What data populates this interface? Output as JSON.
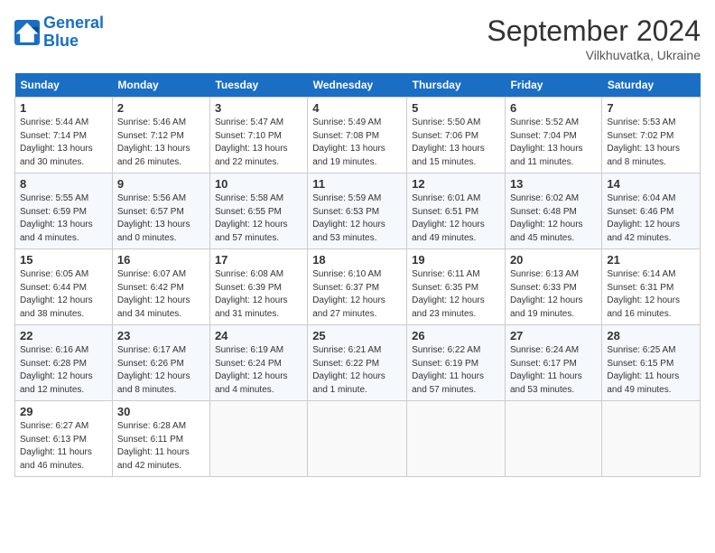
{
  "logo": {
    "text1": "General",
    "text2": "Blue"
  },
  "header": {
    "month": "September 2024",
    "location": "Vilkhuvatka, Ukraine"
  },
  "weekdays": [
    "Sunday",
    "Monday",
    "Tuesday",
    "Wednesday",
    "Thursday",
    "Friday",
    "Saturday"
  ],
  "weeks": [
    [
      {
        "day": "1",
        "info": "Sunrise: 5:44 AM\nSunset: 7:14 PM\nDaylight: 13 hours\nand 30 minutes."
      },
      {
        "day": "2",
        "info": "Sunrise: 5:46 AM\nSunset: 7:12 PM\nDaylight: 13 hours\nand 26 minutes."
      },
      {
        "day": "3",
        "info": "Sunrise: 5:47 AM\nSunset: 7:10 PM\nDaylight: 13 hours\nand 22 minutes."
      },
      {
        "day": "4",
        "info": "Sunrise: 5:49 AM\nSunset: 7:08 PM\nDaylight: 13 hours\nand 19 minutes."
      },
      {
        "day": "5",
        "info": "Sunrise: 5:50 AM\nSunset: 7:06 PM\nDaylight: 13 hours\nand 15 minutes."
      },
      {
        "day": "6",
        "info": "Sunrise: 5:52 AM\nSunset: 7:04 PM\nDaylight: 13 hours\nand 11 minutes."
      },
      {
        "day": "7",
        "info": "Sunrise: 5:53 AM\nSunset: 7:02 PM\nDaylight: 13 hours\nand 8 minutes."
      }
    ],
    [
      {
        "day": "8",
        "info": "Sunrise: 5:55 AM\nSunset: 6:59 PM\nDaylight: 13 hours\nand 4 minutes."
      },
      {
        "day": "9",
        "info": "Sunrise: 5:56 AM\nSunset: 6:57 PM\nDaylight: 13 hours\nand 0 minutes."
      },
      {
        "day": "10",
        "info": "Sunrise: 5:58 AM\nSunset: 6:55 PM\nDaylight: 12 hours\nand 57 minutes."
      },
      {
        "day": "11",
        "info": "Sunrise: 5:59 AM\nSunset: 6:53 PM\nDaylight: 12 hours\nand 53 minutes."
      },
      {
        "day": "12",
        "info": "Sunrise: 6:01 AM\nSunset: 6:51 PM\nDaylight: 12 hours\nand 49 minutes."
      },
      {
        "day": "13",
        "info": "Sunrise: 6:02 AM\nSunset: 6:48 PM\nDaylight: 12 hours\nand 45 minutes."
      },
      {
        "day": "14",
        "info": "Sunrise: 6:04 AM\nSunset: 6:46 PM\nDaylight: 12 hours\nand 42 minutes."
      }
    ],
    [
      {
        "day": "15",
        "info": "Sunrise: 6:05 AM\nSunset: 6:44 PM\nDaylight: 12 hours\nand 38 minutes."
      },
      {
        "day": "16",
        "info": "Sunrise: 6:07 AM\nSunset: 6:42 PM\nDaylight: 12 hours\nand 34 minutes."
      },
      {
        "day": "17",
        "info": "Sunrise: 6:08 AM\nSunset: 6:39 PM\nDaylight: 12 hours\nand 31 minutes."
      },
      {
        "day": "18",
        "info": "Sunrise: 6:10 AM\nSunset: 6:37 PM\nDaylight: 12 hours\nand 27 minutes."
      },
      {
        "day": "19",
        "info": "Sunrise: 6:11 AM\nSunset: 6:35 PM\nDaylight: 12 hours\nand 23 minutes."
      },
      {
        "day": "20",
        "info": "Sunrise: 6:13 AM\nSunset: 6:33 PM\nDaylight: 12 hours\nand 19 minutes."
      },
      {
        "day": "21",
        "info": "Sunrise: 6:14 AM\nSunset: 6:31 PM\nDaylight: 12 hours\nand 16 minutes."
      }
    ],
    [
      {
        "day": "22",
        "info": "Sunrise: 6:16 AM\nSunset: 6:28 PM\nDaylight: 12 hours\nand 12 minutes."
      },
      {
        "day": "23",
        "info": "Sunrise: 6:17 AM\nSunset: 6:26 PM\nDaylight: 12 hours\nand 8 minutes."
      },
      {
        "day": "24",
        "info": "Sunrise: 6:19 AM\nSunset: 6:24 PM\nDaylight: 12 hours\nand 4 minutes."
      },
      {
        "day": "25",
        "info": "Sunrise: 6:21 AM\nSunset: 6:22 PM\nDaylight: 12 hours\nand 1 minute."
      },
      {
        "day": "26",
        "info": "Sunrise: 6:22 AM\nSunset: 6:19 PM\nDaylight: 11 hours\nand 57 minutes."
      },
      {
        "day": "27",
        "info": "Sunrise: 6:24 AM\nSunset: 6:17 PM\nDaylight: 11 hours\nand 53 minutes."
      },
      {
        "day": "28",
        "info": "Sunrise: 6:25 AM\nSunset: 6:15 PM\nDaylight: 11 hours\nand 49 minutes."
      }
    ],
    [
      {
        "day": "29",
        "info": "Sunrise: 6:27 AM\nSunset: 6:13 PM\nDaylight: 11 hours\nand 46 minutes."
      },
      {
        "day": "30",
        "info": "Sunrise: 6:28 AM\nSunset: 6:11 PM\nDaylight: 11 hours\nand 42 minutes."
      },
      {
        "day": "",
        "info": ""
      },
      {
        "day": "",
        "info": ""
      },
      {
        "day": "",
        "info": ""
      },
      {
        "day": "",
        "info": ""
      },
      {
        "day": "",
        "info": ""
      }
    ]
  ]
}
